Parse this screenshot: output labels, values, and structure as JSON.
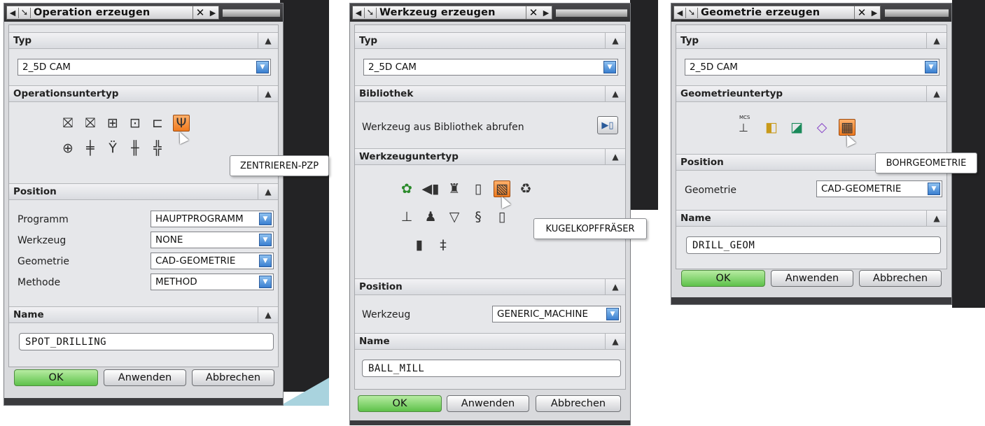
{
  "dialogs": [
    {
      "title": "Operation erzeugen",
      "typ_label": "Typ",
      "typ_value": "2_5D CAM",
      "subtype_label": "Operationsuntertyp",
      "tooltip": "ZENTRIEREN-PZP",
      "position_label": "Position",
      "fields": [
        {
          "label": "Programm",
          "value": "HAUPTPROGRAMM"
        },
        {
          "label": "Werkzeug",
          "value": "NONE"
        },
        {
          "label": "Geometrie",
          "value": "CAD-GEOMETRIE"
        },
        {
          "label": "Methode",
          "value": "METHOD"
        }
      ],
      "name_label": "Name",
      "name_value": "SPOT_DRILLING",
      "ok": "OK",
      "apply": "Anwenden",
      "cancel": "Abbrechen"
    },
    {
      "title": "Werkzeug erzeugen",
      "typ_label": "Typ",
      "typ_value": "2_5D CAM",
      "library_label": "Bibliothek",
      "library_text": "Werkzeug aus Bibliothek abrufen",
      "subtype_label": "Werkzeuguntertyp",
      "tooltip": "KUGELKOPFFRÄSER",
      "position_label": "Position",
      "fields": [
        {
          "label": "Werkzeug",
          "value": "GENERIC_MACHINE"
        }
      ],
      "name_label": "Name",
      "name_value": "BALL_MILL",
      "ok": "OK",
      "apply": "Anwenden",
      "cancel": "Abbrechen"
    },
    {
      "title": "Geometrie erzeugen",
      "typ_label": "Typ",
      "typ_value": "2_5D CAM",
      "subtype_label": "Geometrieuntertyp",
      "mcs_label": "MCS",
      "tooltip": "BOHRGEOMETRIE",
      "position_label": "Position",
      "fields": [
        {
          "label": "Geometrie",
          "value": "CAD-GEOMETRIE"
        }
      ],
      "name_label": "Name",
      "name_value": "DRILL_GEOM",
      "ok": "OK",
      "apply": "Anwenden",
      "cancel": "Abbrechen"
    }
  ],
  "icons": {
    "collapse": "chevron-up-icon",
    "dropdown": "chevron-down-icon",
    "close": "close-icon",
    "pin": "pin-icon"
  },
  "colors": {
    "ok_green": "#5ec14a",
    "selected_orange": "#ef7a1e",
    "dropdown_blue": "#3a7fd0"
  }
}
